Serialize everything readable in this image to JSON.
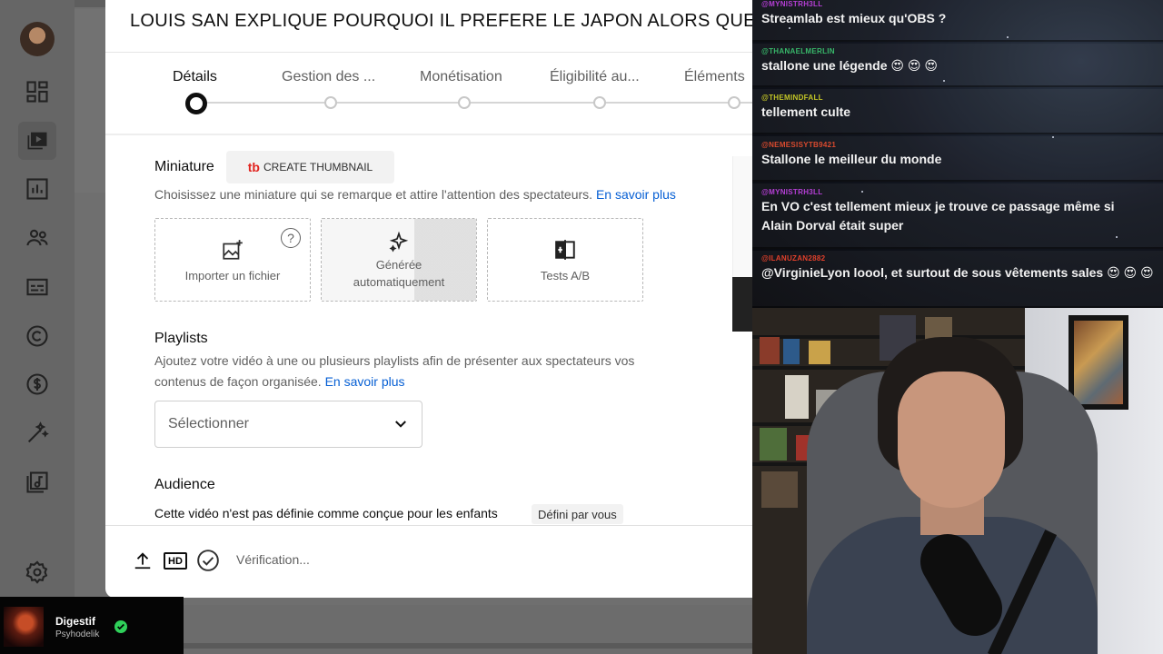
{
  "modal": {
    "video_title": "LOUIS SAN EXPLIQUE POURQUOI IL PREFERE LE JAPON ALORS QUE",
    "steps": [
      {
        "label": "Détails",
        "active": true
      },
      {
        "label": "Gestion des ...",
        "active": false
      },
      {
        "label": "Monétisation",
        "active": false
      },
      {
        "label": "Éligibilité au...",
        "active": false
      },
      {
        "label": "Éléments",
        "active": false
      }
    ],
    "thumbnail": {
      "title": "Miniature",
      "tool_logo": "tb",
      "tool_button": "CREATE THUMBNAIL",
      "description": "Choisissez une miniature qui se remarque et attire l'attention des spectateurs.",
      "learn_more": "En savoir plus",
      "options": {
        "upload": "Importer un fichier",
        "help": "?",
        "auto_line1": "Générée",
        "auto_line2": "automatiquement",
        "ab": "Tests A/B"
      }
    },
    "playlists": {
      "title": "Playlists",
      "description_line1": "Ajoutez votre vidéo à une ou plusieurs playlists afin de présenter aux spectateurs vos",
      "description_line2": "contenus de façon organisée.",
      "learn_more": "En savoir plus",
      "select_value": "Sélectionner"
    },
    "audience": {
      "title": "Audience",
      "text": "Cette vidéo n'est pas définie comme conçue pour les enfants",
      "badge": "Défini par vous"
    },
    "footer": {
      "hd_label": "HD",
      "status": "Vérification..."
    }
  },
  "music": {
    "track": "Digestif",
    "artist": "Psyhodelik"
  },
  "chat": {
    "messages": [
      {
        "user": "@MYNISTRH3LL",
        "user_color": "#b63fd6",
        "text": "Streamlab est mieux qu'OBS ?"
      },
      {
        "user": "@THANAELMERLIN",
        "user_color": "#38b86a",
        "text": "stallone une légende 😍 😍 😍"
      },
      {
        "user": "@THEMINDFALL",
        "user_color": "#c4c626",
        "text": "tellement culte"
      },
      {
        "user": "@NEMESISYTB9421",
        "user_color": "#d94a2e",
        "text": "Stallone le meilleur du monde"
      },
      {
        "user": "@MYNISTRH3LL",
        "user_color": "#b63fd6",
        "text": "En VO c'est tellement mieux je trouve ce passage même si Alain Dorval était super"
      },
      {
        "user": "@ILANUZAN2882",
        "user_color": "#e0402b",
        "text": "@VirginieLyon loool, et surtout de sous vêtements sales 😍 😍 😍"
      }
    ]
  },
  "colors": {
    "link": "#065fd4",
    "status_ok": "#2fd05a",
    "thumbnail_brand": "#e1241f"
  }
}
